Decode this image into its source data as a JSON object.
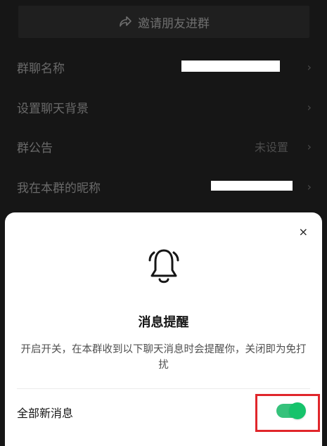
{
  "invite": {
    "label": "邀请朋友进群",
    "icon": "share-icon"
  },
  "settings": {
    "group_name": {
      "label": "群聊名称"
    },
    "background": {
      "label": "设置聊天背景"
    },
    "announcement": {
      "label": "群公告",
      "value": "未设置"
    },
    "nickname": {
      "label": "我在本群的昵称"
    }
  },
  "sheet": {
    "title": "消息提醒",
    "description": "开启开关，在本群收到以下聊天消息时会提醒你，关闭即为免打扰",
    "option_label": "全部新消息",
    "option_enabled": true,
    "close_icon": "×",
    "bell_icon": "bell-icon"
  },
  "colors": {
    "background": "#161616",
    "toggle_on": "#16c36b",
    "highlight": "#e0262b"
  }
}
